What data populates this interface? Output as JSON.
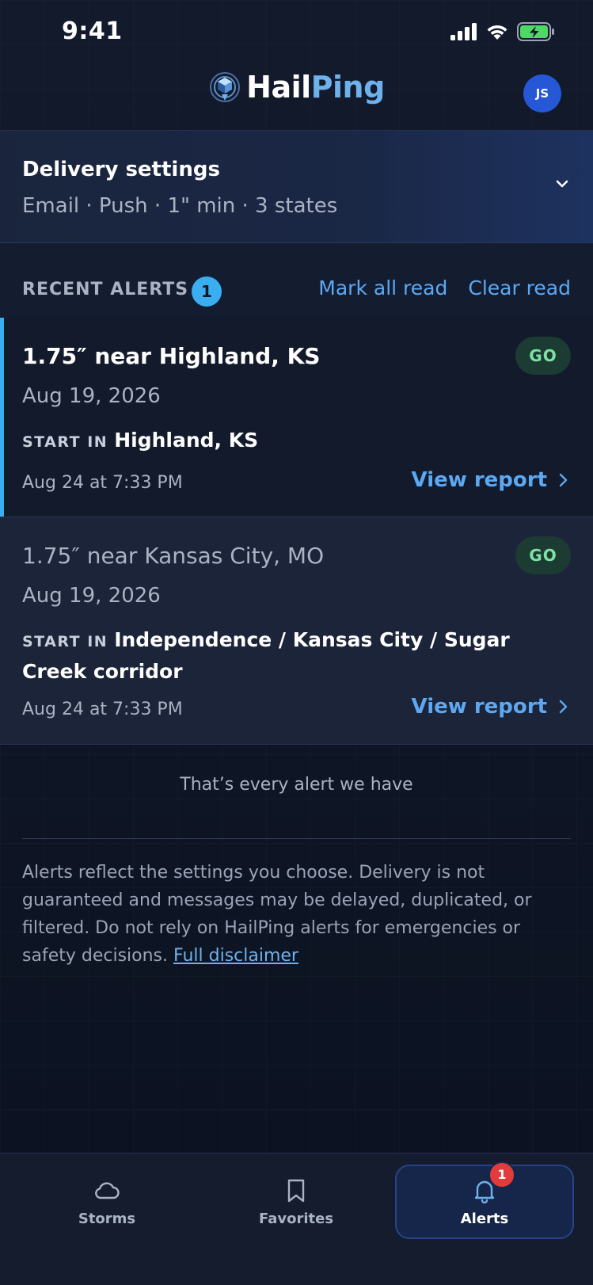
{
  "status_bar": {
    "time": "9:41"
  },
  "header": {
    "logo_part1": "Hail",
    "logo_part2": "Ping",
    "avatar_initials": "JS"
  },
  "delivery": {
    "title": "Delivery settings",
    "summary": "Email · Push · 1\" min · 3 states"
  },
  "recent_alerts": {
    "label": "RECENT ALERTS",
    "count": "1",
    "mark_all_read": "Mark all read",
    "clear_read": "Clear read"
  },
  "alerts": [
    {
      "title": "1.75″ near Highland, KS",
      "date": "Aug 19, 2026",
      "start_label": "START IN",
      "start_value": "Highland, KS",
      "time": "Aug 24 at 7:33 PM",
      "badge": "GO",
      "action": "View report",
      "unread": true
    },
    {
      "title": "1.75″ near Kansas City, MO",
      "date": "Aug 19, 2026",
      "start_label": "START IN",
      "start_value": "Independence / Kansas City / Sugar Creek corridor",
      "time": "Aug 24 at 7:33 PM",
      "badge": "GO",
      "action": "View report",
      "unread": false
    }
  ],
  "end_note": "That’s every alert we have",
  "disclaimer": {
    "text": "Alerts reflect the settings you choose. Delivery is not guaranteed and messages may be delayed, duplicated, or filtered. Do not rely on HailPing alerts for emergencies or safety decisions. ",
    "link": "Full disclaimer"
  },
  "tabs": [
    {
      "label": "Storms",
      "icon": "cloud-icon",
      "active": false
    },
    {
      "label": "Favorites",
      "icon": "bookmark-icon",
      "active": false
    },
    {
      "label": "Alerts",
      "icon": "bell-icon",
      "active": true,
      "badge": "1"
    }
  ],
  "colors": {
    "accent": "#3aaef0",
    "link": "#5ea8f2",
    "go_badge_bg": "#1b3b33",
    "go_badge_text": "#7ee2a2",
    "notification": "#e33b3b",
    "avatar": "#2557d6"
  }
}
